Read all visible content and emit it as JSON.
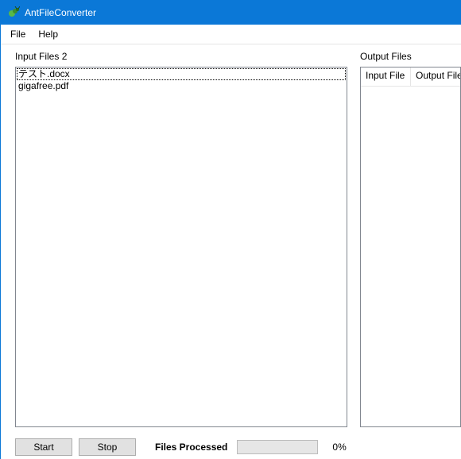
{
  "window": {
    "title": "AntFileConverter"
  },
  "menu": {
    "file": "File",
    "help": "Help"
  },
  "input_panel": {
    "label_prefix": "Input Files  ",
    "count": "2",
    "items": [
      "テスト.docx",
      "gigafree.pdf"
    ],
    "selected_index": 0
  },
  "output_panel": {
    "label": "Output Files",
    "columns": [
      "Input File",
      "Output File"
    ]
  },
  "buttons": {
    "start": "Start",
    "stop": "Stop"
  },
  "status": {
    "files_processed_label": "Files Processed",
    "percent_label": "0%"
  }
}
